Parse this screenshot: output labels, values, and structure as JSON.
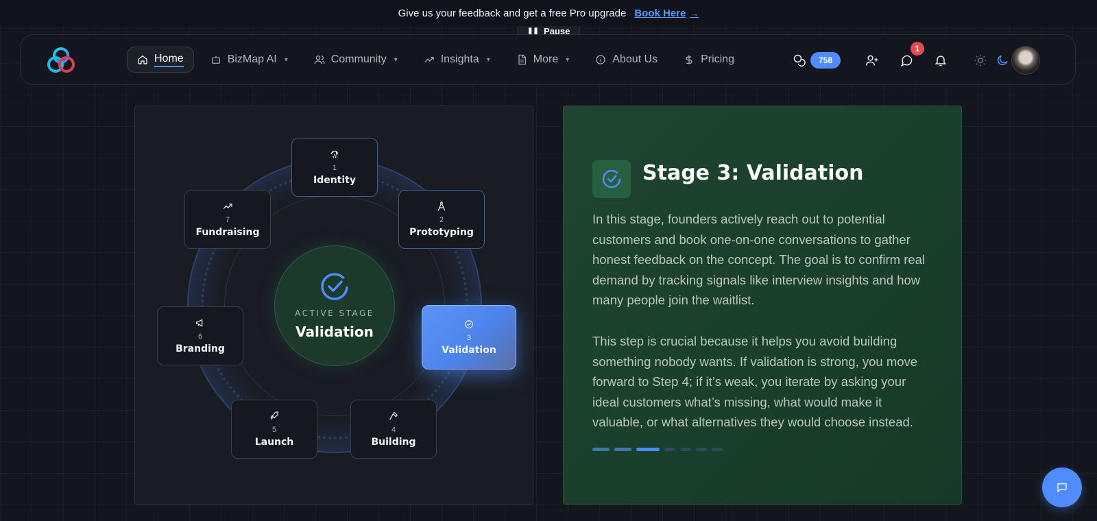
{
  "announcement": {
    "text": "Give us your feedback and get a free Pro upgrade",
    "link_label": "Book Here",
    "link_arrow": "→",
    "pause_label": "Pause"
  },
  "nav": {
    "items": [
      {
        "label": "Home",
        "icon": "home-icon",
        "active": true,
        "dropdown": false
      },
      {
        "label": "BizMap AI",
        "icon": "bot-icon",
        "active": false,
        "dropdown": true
      },
      {
        "label": "Community",
        "icon": "users-icon",
        "active": false,
        "dropdown": true
      },
      {
        "label": "Insighta",
        "icon": "trend-icon",
        "active": false,
        "dropdown": true
      },
      {
        "label": "More",
        "icon": "document-icon",
        "active": false,
        "dropdown": true
      },
      {
        "label": "About Us",
        "icon": "info-icon",
        "active": false,
        "dropdown": false
      },
      {
        "label": "Pricing",
        "icon": "dollar-icon",
        "active": false,
        "dropdown": false
      }
    ],
    "credits": "758",
    "notification_count": "1"
  },
  "cycle": {
    "active_caption": "ACTIVE STAGE",
    "active_name": "Validation",
    "stages": [
      {
        "num": "1",
        "label": "Identity",
        "icon": "fingerprint-icon"
      },
      {
        "num": "2",
        "label": "Prototyping",
        "icon": "compass-icon"
      },
      {
        "num": "3",
        "label": "Validation",
        "icon": "check-circle-icon"
      },
      {
        "num": "4",
        "label": "Building",
        "icon": "hammer-icon"
      },
      {
        "num": "5",
        "label": "Launch",
        "icon": "rocket-icon"
      },
      {
        "num": "6",
        "label": "Branding",
        "icon": "megaphone-icon"
      },
      {
        "num": "7",
        "label": "Fundraising",
        "icon": "trending-up-icon"
      }
    ]
  },
  "detail": {
    "title": "Stage 3: Validation",
    "paragraph1": "In this stage, founders actively reach out to potential customers and book one-on-one conversations to gather honest feedback on the concept. The goal is to confirm real demand by tracking signals like interview insights and how many people join the waitlist.",
    "paragraph2": "This step is crucial because it helps you avoid building something nobody wants. If validation is strong, you move forward to Step 4; if it’s weak, you iterate by asking your ideal customers what’s missing, what would make it valuable, or what alternatives they would choose instead.",
    "current_stage": 3,
    "total_stages": 7
  },
  "colors": {
    "accent": "#4f8cff",
    "panel_green": "#1e4530",
    "notification": "#e5484d"
  }
}
